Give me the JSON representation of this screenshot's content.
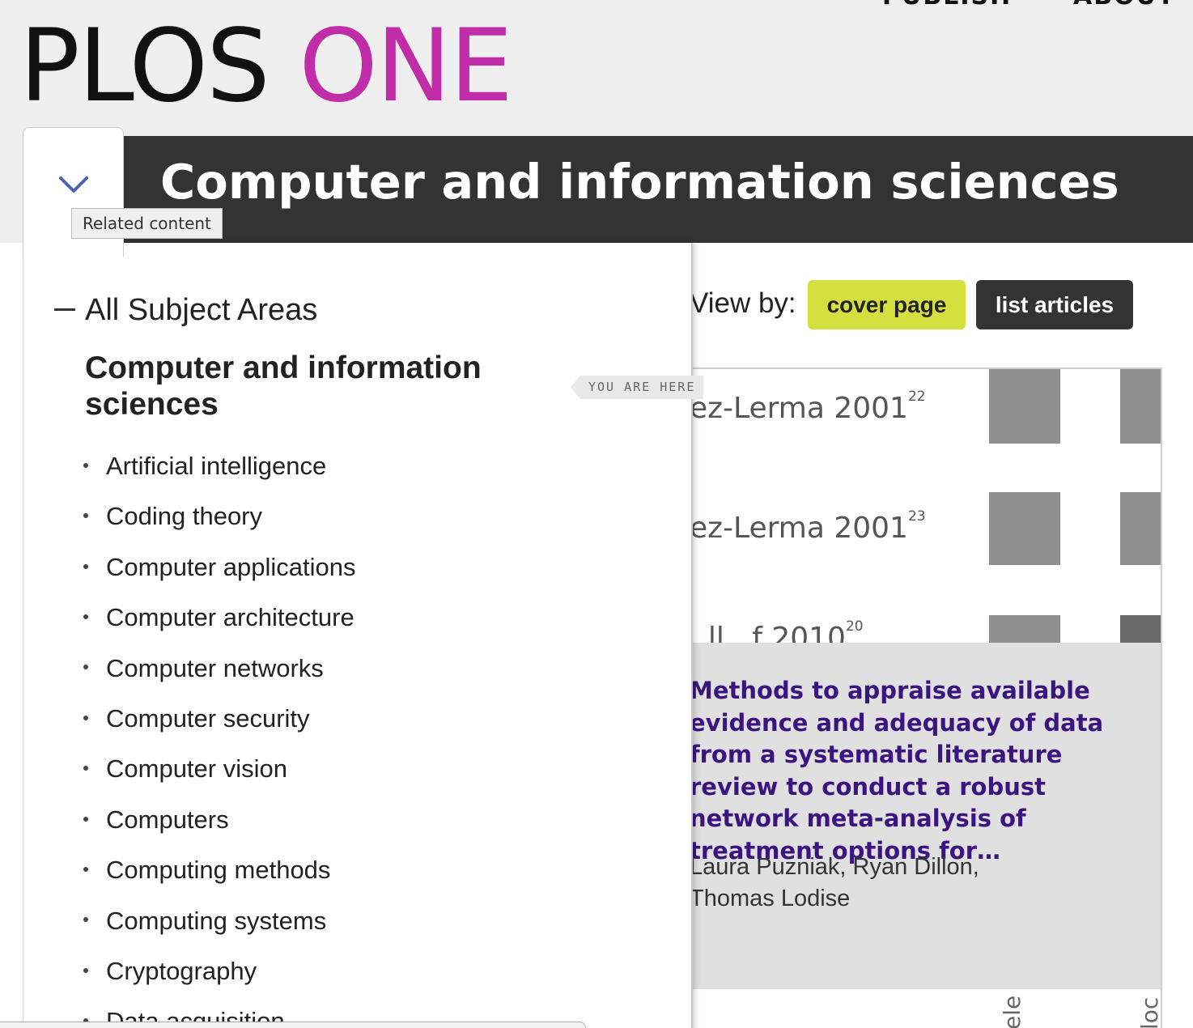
{
  "header": {
    "nav_publish": "PUBLISH",
    "nav_about": "ABOUT",
    "logo_part1": "PLOS",
    "logo_part2": "ONE",
    "brand_color": "#c12ca8"
  },
  "page_title": "Computer and information sciences",
  "toggle": {
    "icon": "chevron-down-icon",
    "tooltip": "Related content"
  },
  "subject_panel": {
    "all_subjects": "All Subject Areas",
    "current": "Computer and information sciences",
    "you_are_here": "YOU ARE HERE",
    "items": [
      "Artificial intelligence",
      "Coding theory",
      "Computer applications",
      "Computer architecture",
      "Computer networks",
      "Computer security",
      "Computer vision",
      "Computers",
      "Computing methods",
      "Computing systems",
      "Cryptography",
      "Data acquisition"
    ]
  },
  "view_by": {
    "label": "View by:",
    "cover_page": "cover page",
    "list_articles": "list articles",
    "cover_color": "#d6df40"
  },
  "article": {
    "figure_labels": [
      {
        "text": "ez-Lerma 2001",
        "ref": "22"
      },
      {
        "text": "ez-Lerma 2001",
        "ref": "23"
      },
      {
        "text": "..ll...f 2010",
        "ref": "20"
      }
    ],
    "title": "Methods to appraise available evidence and adequacy of data from a systematic literature review to conduct a robust network meta-analysis of treatment options for…",
    "authors": "Laura Puzniak, Ryan Dillon, Thomas Lodise",
    "bottom_labels": [
      "ele",
      "loc"
    ],
    "title_color": "#3c1480"
  }
}
